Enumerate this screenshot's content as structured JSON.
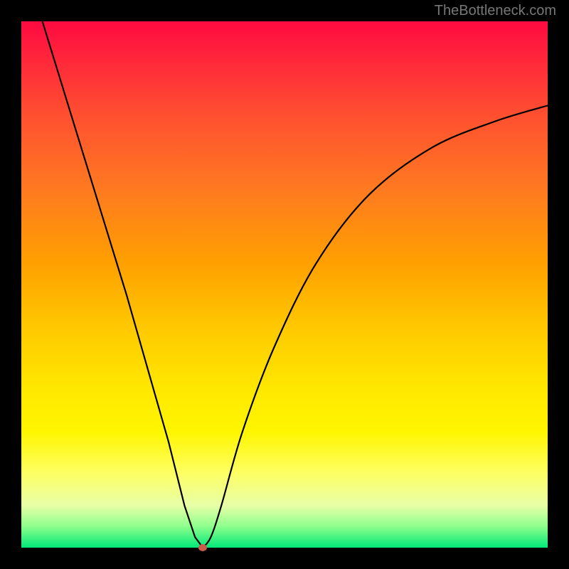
{
  "watermark": "TheBottleneck.com",
  "chart_data": {
    "type": "line",
    "title": "",
    "xlabel": "",
    "ylabel": "",
    "xlim": [
      0,
      100
    ],
    "ylim": [
      0,
      100
    ],
    "series": [
      {
        "name": "bottleneck-curve",
        "x": [
          4,
          8,
          12,
          16,
          20,
          24,
          28,
          31,
          33,
          34.5,
          36,
          38,
          42,
          48,
          56,
          66,
          78,
          90,
          100
        ],
        "y": [
          100,
          87,
          74,
          61,
          48,
          34,
          20,
          8,
          2,
          0,
          2,
          8,
          22,
          38,
          54,
          67,
          76,
          81,
          84
        ]
      }
    ],
    "marker": {
      "x": 34.5,
      "y": 0,
      "color": "#cc5a4a"
    },
    "background_gradient": {
      "type": "vertical",
      "stops": [
        {
          "pos": 0,
          "color": "#ff0a40"
        },
        {
          "pos": 50,
          "color": "#ffc800"
        },
        {
          "pos": 80,
          "color": "#ffff66"
        },
        {
          "pos": 100,
          "color": "#00e878"
        }
      ]
    }
  }
}
